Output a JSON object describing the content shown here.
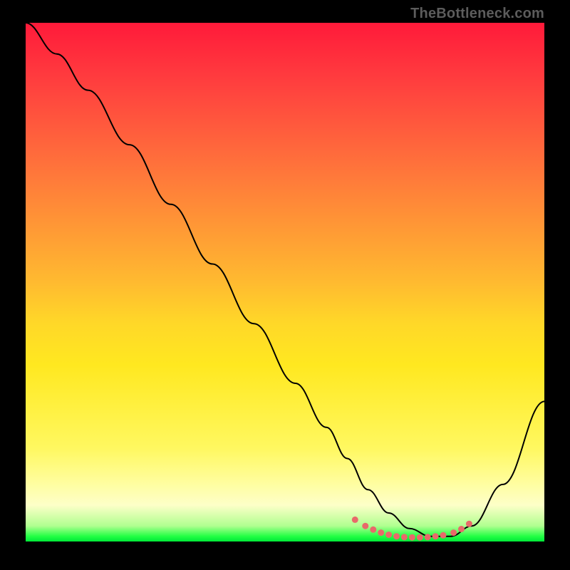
{
  "watermark": "TheBottleneck.com",
  "chart_data": {
    "type": "line",
    "title": "",
    "xlabel": "",
    "ylabel": "",
    "xlim": [
      0,
      100
    ],
    "ylim": [
      0,
      100
    ],
    "grid": false,
    "series": [
      {
        "name": "bottleneck-curve",
        "x": [
          0,
          6,
          12,
          20,
          28,
          36,
          44,
          52,
          58,
          62,
          66,
          70,
          74,
          78,
          82,
          86,
          92,
          100
        ],
        "y": [
          100,
          94,
          87,
          76.5,
          65,
          53.5,
          42,
          30.5,
          22,
          16,
          10,
          5.5,
          2.5,
          1,
          1,
          3,
          11,
          27
        ],
        "color": "#000000"
      }
    ],
    "markers": {
      "name": "highlighted-points",
      "color": "#e86a6a",
      "points": [
        {
          "x": 63.5,
          "y": 4.2
        },
        {
          "x": 65.5,
          "y": 3.0
        },
        {
          "x": 67.0,
          "y": 2.3
        },
        {
          "x": 68.5,
          "y": 1.7
        },
        {
          "x": 70.0,
          "y": 1.3
        },
        {
          "x": 71.5,
          "y": 1.0
        },
        {
          "x": 73.0,
          "y": 0.85
        },
        {
          "x": 74.5,
          "y": 0.8
        },
        {
          "x": 76.0,
          "y": 0.8
        },
        {
          "x": 77.5,
          "y": 0.85
        },
        {
          "x": 79.0,
          "y": 1.0
        },
        {
          "x": 80.5,
          "y": 1.2
        },
        {
          "x": 82.5,
          "y": 1.7
        },
        {
          "x": 84.0,
          "y": 2.4
        },
        {
          "x": 85.5,
          "y": 3.4
        }
      ]
    }
  }
}
